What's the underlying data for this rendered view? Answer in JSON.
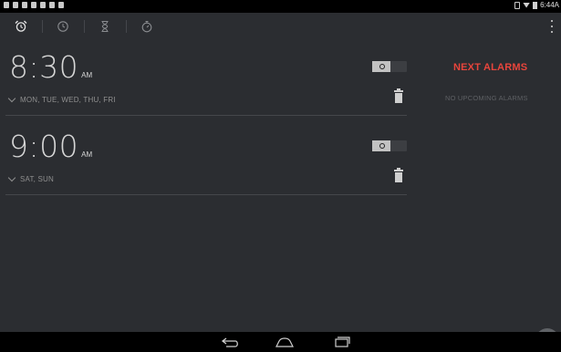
{
  "status_bar": {
    "time": "6:44",
    "time_suffix": "A"
  },
  "tabs": [
    {
      "name": "alarm",
      "icon": "alarm-clock-icon"
    },
    {
      "name": "clock",
      "icon": "clock-icon"
    },
    {
      "name": "timer",
      "icon": "hourglass-icon"
    },
    {
      "name": "stopwatch",
      "icon": "stopwatch-icon"
    }
  ],
  "alarms": [
    {
      "time": "8:30",
      "ampm": "AM",
      "days": "MON, TUE, WED, THU, FRI",
      "enabled": false
    },
    {
      "time": "9:00",
      "ampm": "AM",
      "days": "SAT, SUN",
      "enabled": false
    }
  ],
  "next_alarms": {
    "title": "NEXT ALARMS",
    "empty_text": "NO UPCOMING ALARMS"
  },
  "colors": {
    "accent": "#e8453c",
    "background": "#2b2d31"
  },
  "nav": {
    "back": "back-icon",
    "home": "home-icon",
    "recents": "recents-icon"
  }
}
